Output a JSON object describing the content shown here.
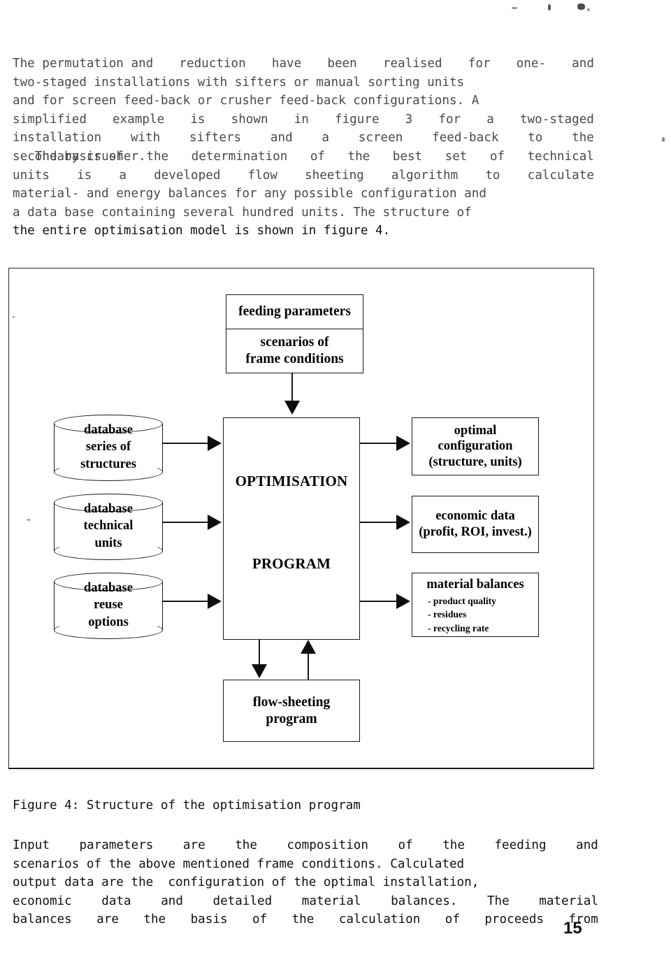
{
  "page": {
    "number": "15"
  },
  "paragraphs": {
    "top": [
      [
        "The permutation and",
        "reduction",
        "have",
        "been",
        "realised",
        "for",
        "one-",
        "and"
      ],
      [
        "two-staged installations with sifters or manual sorting units"
      ],
      [
        "and for screen feed-back or crusher feed-back configurations. A"
      ],
      [
        "simplified",
        "example",
        "is",
        "shown",
        "in",
        "figure",
        "3",
        "for",
        "a",
        "two-staged"
      ],
      [
        "installation",
        "with",
        "sifters",
        "and",
        "a",
        "screen",
        "feed-back",
        "to",
        "the"
      ],
      [
        "secondary crusher."
      ]
    ],
    "mid": [
      [
        "   The basis of",
        "the",
        "determination",
        "of",
        "the",
        "best",
        "set",
        "of",
        "technical"
      ],
      [
        "units",
        "is",
        "a",
        "developed",
        "flow",
        "sheeting",
        "algorithm",
        "to",
        "calculate"
      ],
      [
        "material- and energy balances for any possible configuration and"
      ],
      [
        "a data base containing several hundred units. The structure of"
      ],
      [
        "the entire optimisation model is shown in figure 4."
      ]
    ],
    "bottom": [
      [
        "Input",
        "parameters",
        "are",
        "the",
        "composition",
        "of",
        "the",
        "feeding",
        "and"
      ],
      [
        "scenarios of the above mentioned frame conditions. Calculated"
      ],
      [
        "output data are the  configuration of the optimal installation,"
      ],
      [
        "economic",
        "data",
        "and",
        "detailed",
        "material",
        "balances.",
        "The",
        "material"
      ],
      [
        "balances",
        "are",
        "the",
        "basis",
        "of",
        "the",
        "calculation",
        "of",
        "proceeds",
        "from"
      ]
    ]
  },
  "figure": {
    "caption": "Figure 4: Structure of the optimisation program",
    "inputs": {
      "feeding_parameters": "feeding parameters",
      "scenarios_line1": "scenarios of",
      "scenarios_line2": "frame conditions"
    },
    "databases": [
      {
        "name": "database",
        "line2": "series of",
        "line3": "structures"
      },
      {
        "name": "database",
        "line2": "technical",
        "line3": "units"
      },
      {
        "name": "database",
        "line2": "reuse",
        "line3": "options"
      }
    ],
    "program": {
      "line1": "OPTIMISATION",
      "line2": "PROGRAM"
    },
    "outputs": [
      {
        "line1": "optimal",
        "line2": "configuration",
        "line3": "(structure, units)"
      },
      {
        "line1": "economic data",
        "line2": "(profit, ROI, invest.)"
      },
      {
        "title": "material balances",
        "items": [
          "- product quality",
          "- residues",
          "- recycling rate"
        ]
      }
    ],
    "flowsheet": {
      "line1": "flow-sheeting",
      "line2": "program"
    }
  },
  "colors": {
    "ink": "#171717",
    "paper": "#ffffff",
    "arrow": "#0d0d0d"
  }
}
